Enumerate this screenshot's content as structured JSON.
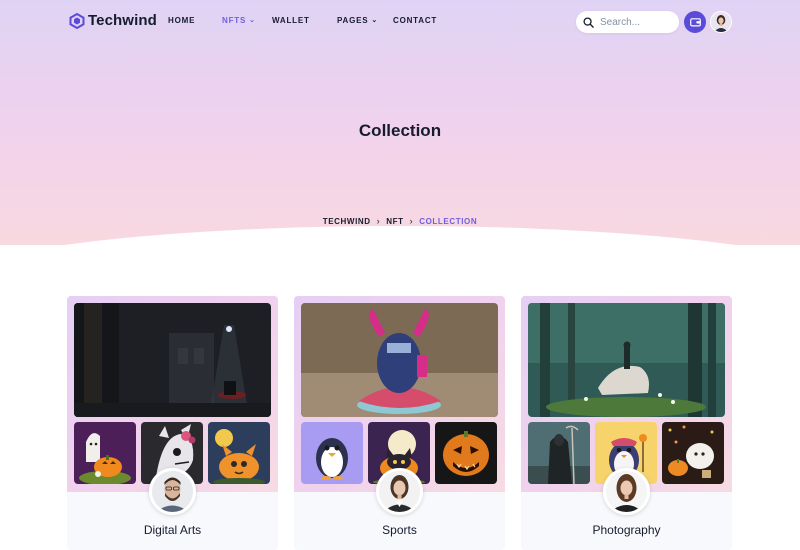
{
  "brand": {
    "name": "Techwind",
    "accent": "#5a4bd8"
  },
  "nav": {
    "items": [
      {
        "label": "HOME"
      },
      {
        "label": "NFTS"
      },
      {
        "label": "WALLET"
      },
      {
        "label": "PAGES"
      },
      {
        "label": "CONTACT"
      }
    ],
    "active_item": "NFTS"
  },
  "search": {
    "placeholder": "Search..."
  },
  "header_icons": {
    "wallet": "wallet-icon",
    "search": "search-icon",
    "user": "user-avatar"
  },
  "page": {
    "title": "Collection"
  },
  "breadcrumb": {
    "items": [
      "TECHWIND",
      "NFT",
      "COLLECTION"
    ]
  },
  "collections": [
    {
      "title": "Digital Arts"
    },
    {
      "title": "Sports"
    },
    {
      "title": "Photography"
    }
  ]
}
